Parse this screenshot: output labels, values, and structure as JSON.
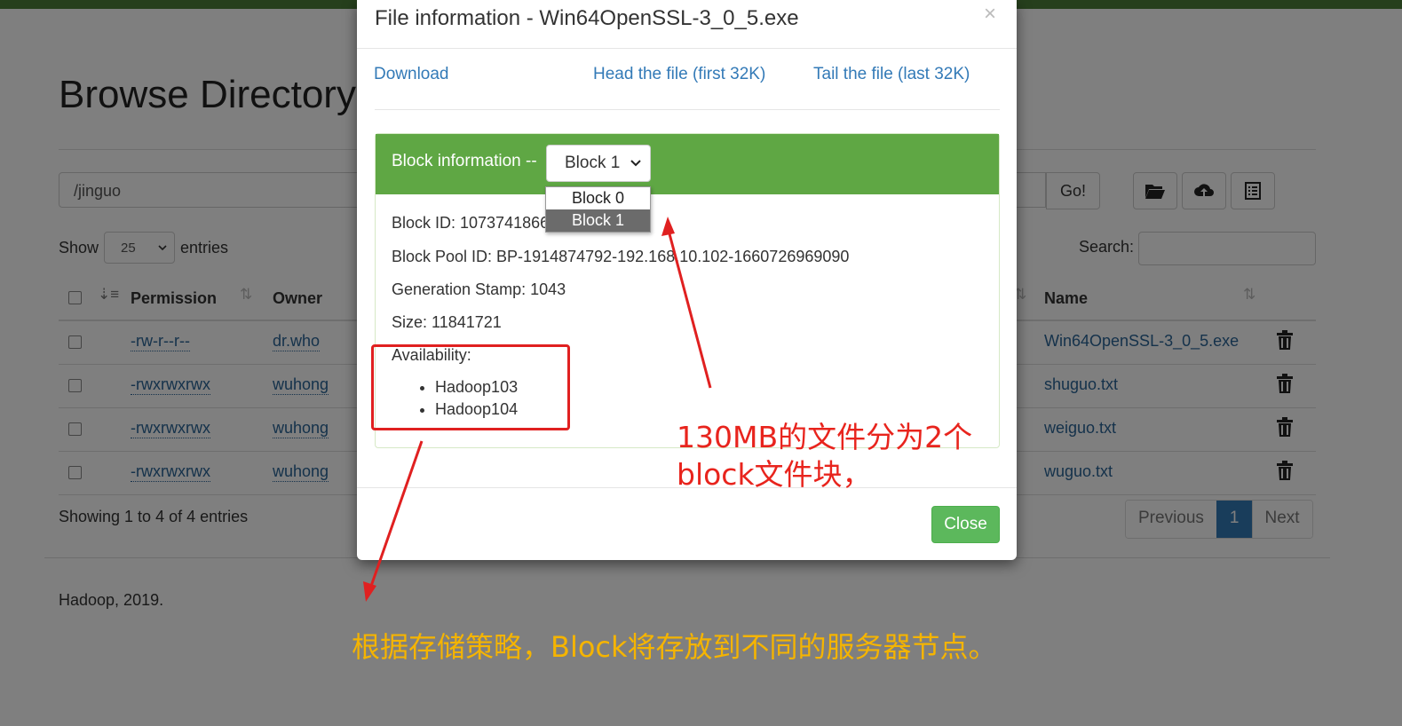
{
  "page": {
    "title": "Browse Directory",
    "path_value": "/jinguo",
    "go_label": "Go!",
    "show_label": "Show",
    "entries_value": "25",
    "entries_label": "entries",
    "search_label": "Search:",
    "columns": [
      "Permission",
      "Owner",
      "Name"
    ],
    "rows": [
      {
        "permission": "-rw-r--r--",
        "owner": "dr.who",
        "name": "Win64OpenSSL-3_0_5.exe"
      },
      {
        "permission": "-rwxrwxrwx",
        "owner": "wuhong",
        "name": "shuguo.txt"
      },
      {
        "permission": "-rwxrwxrwx",
        "owner": "wuhong",
        "name": "weiguo.txt"
      },
      {
        "permission": "-rwxrwxrwx",
        "owner": "wuhong",
        "name": "wuguo.txt"
      }
    ],
    "info_text": "Showing 1 to 4 of 4 entries",
    "pager": {
      "previous": "Previous",
      "current": "1",
      "next": "Next"
    },
    "footer": "Hadoop, 2019."
  },
  "modal": {
    "title": "File information - Win64OpenSSL-3_0_5.exe",
    "close_x": "×",
    "links": {
      "download": "Download",
      "head": "Head the file (first 32K)",
      "tail": "Tail the file (last 32K)"
    },
    "block_heading": "Block information --",
    "block_selected": "Block 1",
    "block_options": [
      "Block 0",
      "Block 1"
    ],
    "block_id": "Block ID: 1073741866",
    "block_pool_id": "Block Pool ID: BP-1914874792-192.168.10.102-1660726969090",
    "generation_stamp": "Generation Stamp: 1043",
    "size": "Size: 11841721",
    "availability_label": "Availability:",
    "availability": [
      "Hadoop103",
      "Hadoop104"
    ],
    "close_label": "Close"
  },
  "annotations": {
    "note1_line1": "130MB的文件分为2个",
    "note1_line2": "block文件块，",
    "note2": "根据存储策略，Block将存放到不同的服务器节点。"
  },
  "colors": {
    "panel_heading": "#5fa744",
    "close_button": "#5cb85c",
    "link": "#337ab7",
    "annotation_red": "#e8241d",
    "annotation_yellow": "#f5b400"
  }
}
